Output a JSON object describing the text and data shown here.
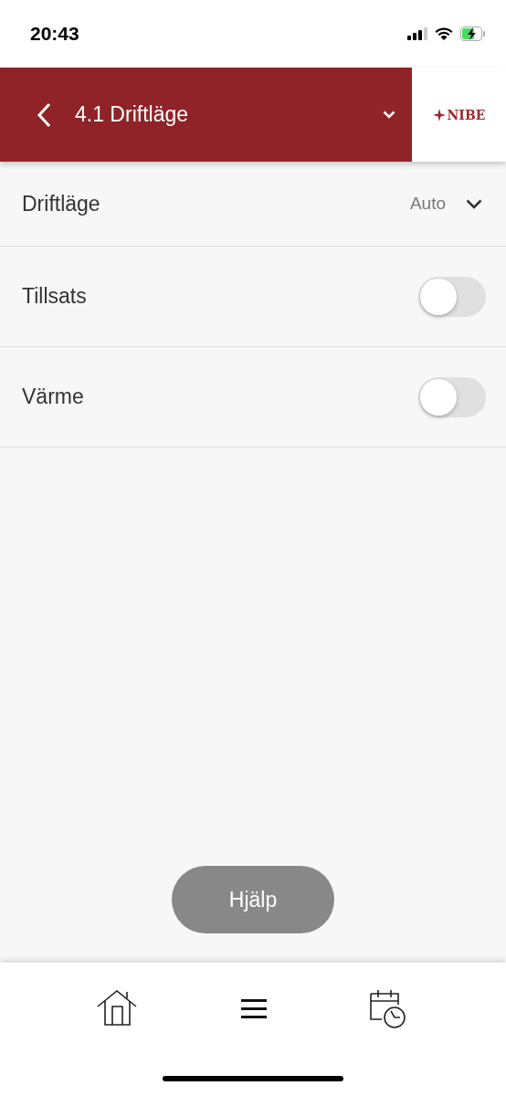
{
  "status_bar": {
    "time": "20:43"
  },
  "header": {
    "title": "4.1 Driftläge",
    "logo": "NIBE"
  },
  "settings": [
    {
      "kind": "select",
      "label": "Driftläge",
      "value": "Auto"
    },
    {
      "kind": "toggle",
      "label": "Tillsats",
      "on": false
    },
    {
      "kind": "toggle",
      "label": "Värme",
      "on": false
    }
  ],
  "help_button": "Hjälp"
}
